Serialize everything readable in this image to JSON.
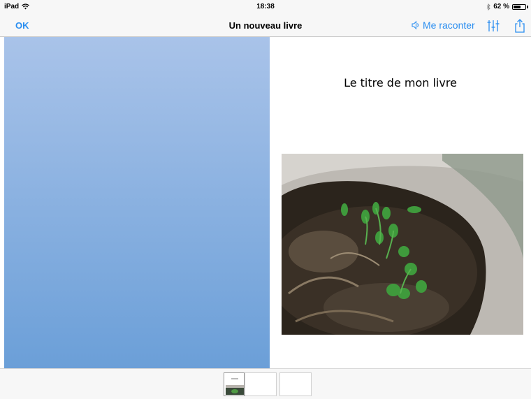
{
  "status": {
    "device": "iPad",
    "time": "18:38",
    "battery_percent": "62 %",
    "battery_level": 0.62
  },
  "nav": {
    "ok_label": "OK",
    "title": "Un nouveau livre",
    "read_label": "Me raconter",
    "read_icon": "speaker-icon",
    "settings_icon": "sliders-icon",
    "share_icon": "share-icon"
  },
  "page": {
    "title_text": "Le titre de mon livre",
    "photo": "potted-plant-clover-photo"
  },
  "thumbnails": {
    "count": 3,
    "selected_index": 0
  },
  "colors": {
    "accent": "#2a8ef0",
    "left_page_top": "#a9c3e9",
    "left_page_bottom": "#6b9fd8"
  }
}
